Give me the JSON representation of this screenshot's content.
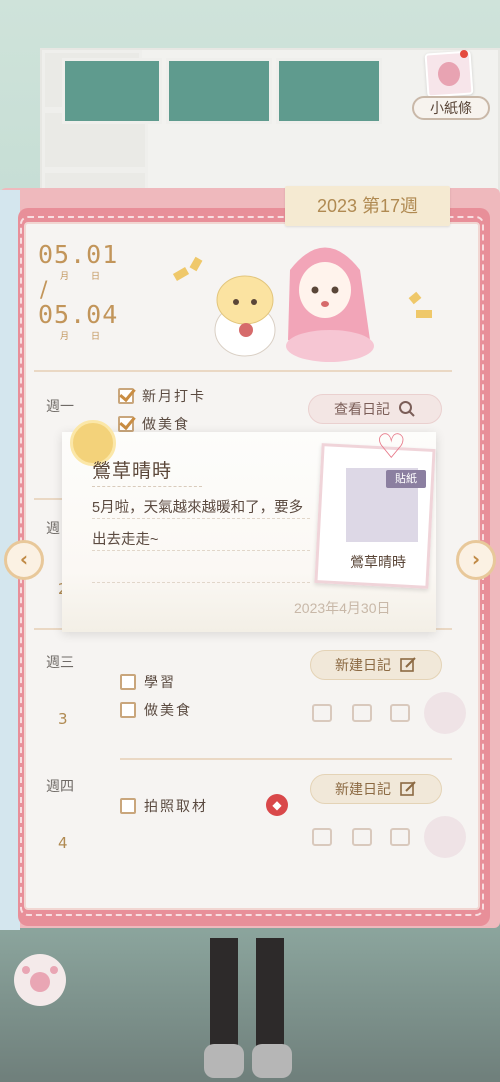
{
  "header": {
    "note_button_label": "小紙條",
    "week_tab": "2023 第17週"
  },
  "date_range": {
    "start": "05.01",
    "end": "05.04",
    "month_char": "月",
    "day_char": "日",
    "slash": "/"
  },
  "days": [
    {
      "label": "週一",
      "tasks": [
        {
          "text": "新月打卡",
          "checked": true
        },
        {
          "text": "做美食",
          "checked": true
        }
      ],
      "action": "查看日記"
    },
    {
      "label": "週",
      "number": "2"
    },
    {
      "label": "週三",
      "number": "3",
      "tasks": [
        {
          "text": "學習",
          "checked": false
        },
        {
          "text": "做美食",
          "checked": false
        }
      ],
      "action": "新建日記"
    },
    {
      "label": "週四",
      "number": "4",
      "tasks": [
        {
          "text": "拍照取材",
          "checked": false
        }
      ],
      "action": "新建日記"
    }
  ],
  "popup": {
    "title": "鶯草晴時",
    "body": "5月啦，天氣越來越暖和了，要多出去走走~",
    "date": "2023年4月30日",
    "sticker_tag": "貼紙",
    "sticker_name": "鶯草晴時"
  },
  "colors": {
    "accent_pink": "#e88f99",
    "gold_text": "#b08a52",
    "page_bg": "#f6f4f2"
  },
  "icons": {
    "search": "search-icon",
    "edit": "edit-icon",
    "gift": "gift-icon",
    "prev": "chevron-left-icon",
    "next": "chevron-right-icon",
    "heart": "heart-icon"
  }
}
